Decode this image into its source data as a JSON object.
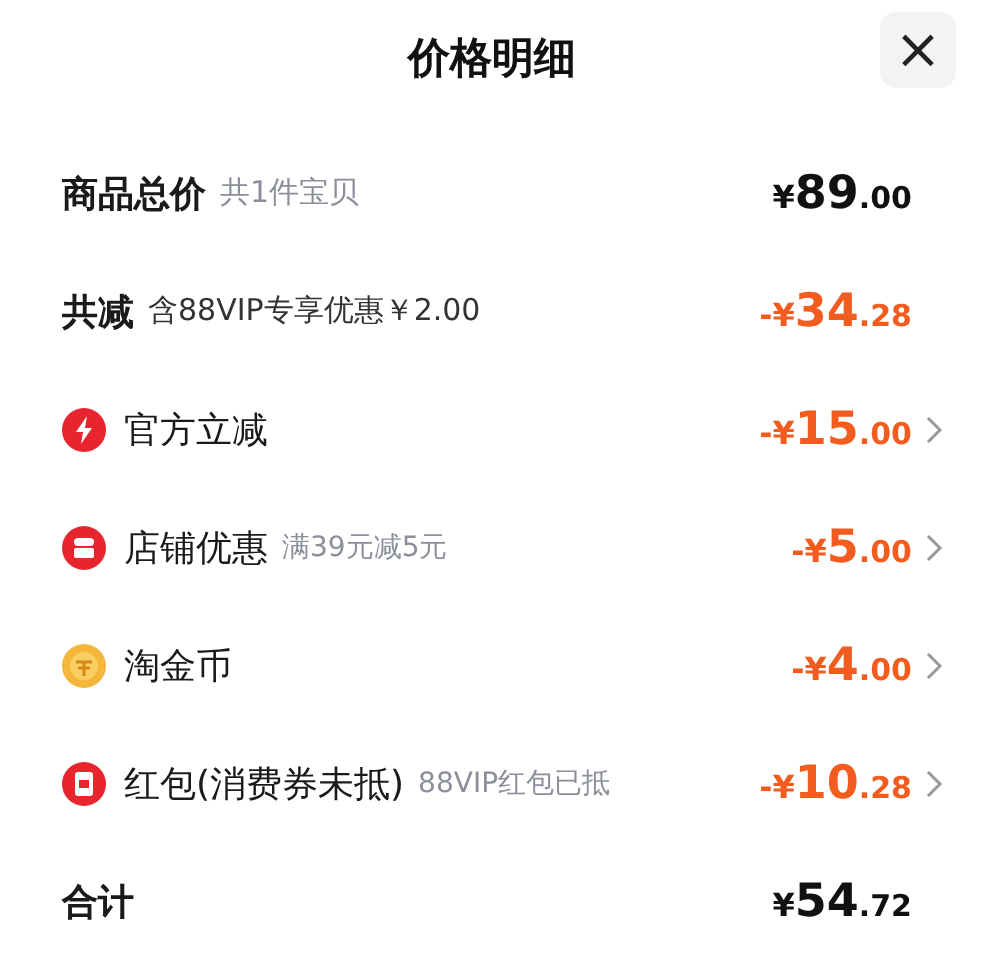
{
  "title": "价格明细",
  "close": "×",
  "summary": [
    {
      "label": "商品总价",
      "note": "共1件宝贝",
      "price": {
        "currency": "¥",
        "amount": "89",
        "cents": ".00"
      },
      "negative": false
    },
    {
      "label": "共减",
      "note": "含88VIP专享优惠￥2.00",
      "price": {
        "currency": "-¥",
        "amount": "34",
        "cents": ".28"
      },
      "negative": true
    }
  ],
  "discounts": [
    {
      "label": "官方立减",
      "price": {
        "currency": "-¥",
        "amount": "15",
        "cents": ".00"
      }
    },
    {
      "label": "店铺优惠",
      "note": "满39元减5元",
      "price": {
        "currency": "-¥",
        "amount": "5",
        "cents": ".00"
      }
    },
    {
      "label": "淘金币",
      "price": {
        "currency": "-¥",
        "amount": "4",
        "cents": ".00"
      }
    },
    {
      "label": "红包(消费券未抵)",
      "note": "88VIP红包已抵",
      "price": {
        "currency": "-¥",
        "amount": "10",
        "cents": ".28"
      }
    }
  ],
  "total": {
    "label": "合计",
    "price": {
      "currency": "¥",
      "amount": "54",
      "cents": ".72"
    }
  }
}
